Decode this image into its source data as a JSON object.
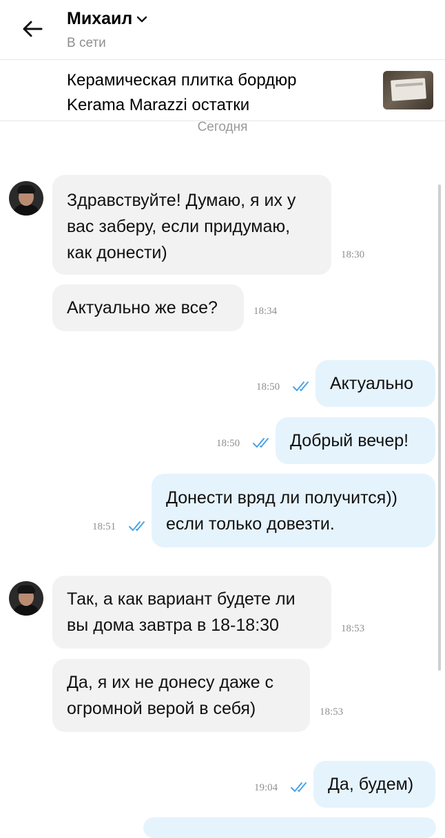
{
  "header": {
    "contact_name": "Михаил",
    "status": "В сети"
  },
  "item": {
    "title_line1": "Керамическая плитка бордюр",
    "title_line2": "Kerama Marazzi остатки"
  },
  "date_separator": "Сегодня",
  "messages": [
    {
      "dir": "in",
      "lines": [
        "Здравствуйте! Думаю, я их у",
        "вас заберу, если придумаю,",
        "как донести)"
      ],
      "time": "18:30"
    },
    {
      "dir": "in",
      "lines": [
        "Актуально же все?"
      ],
      "time": "18:34"
    },
    {
      "dir": "out",
      "lines": [
        "Актуально"
      ],
      "time": "18:50",
      "read": true
    },
    {
      "dir": "out",
      "lines": [
        "Добрый вечер!"
      ],
      "time": "18:50",
      "read": true
    },
    {
      "dir": "out",
      "lines": [
        "Донести вряд ли получится))",
        "если только довезти."
      ],
      "time": "18:51",
      "read": true
    },
    {
      "dir": "in",
      "lines": [
        "Так, а как вариант будете ли",
        "вы дома завтра в 18-18:30"
      ],
      "time": "18:53"
    },
    {
      "dir": "in",
      "lines": [
        "Да, я их не донесу даже с",
        "огромной верой в себя)"
      ],
      "time": "18:53"
    },
    {
      "dir": "out",
      "lines": [
        "Да, будем)"
      ],
      "time": "19:04",
      "read": true
    }
  ],
  "colors": {
    "incoming_bubble": "#f2f2f2",
    "outgoing_bubble": "#e5f3fd",
    "read_checks": "#4aa3e8"
  },
  "icons": {
    "back": "arrow-left-icon",
    "name_dropdown": "chevron-down-icon",
    "read_status": "double-check-icon"
  }
}
